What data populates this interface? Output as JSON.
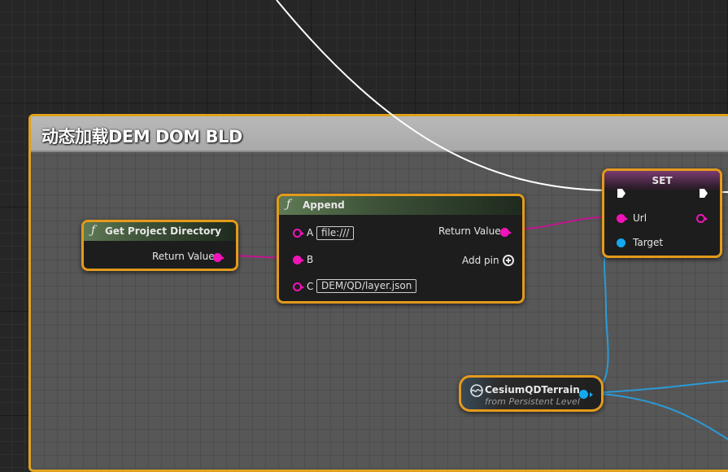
{
  "comment": {
    "title": "动态加载DEM DOM BLD"
  },
  "nodes": {
    "get_project_directory": {
      "fx": "ƒ",
      "title": "Get Project Directory",
      "return_label": "Return Value"
    },
    "append": {
      "fx": "ƒ",
      "title": "Append",
      "pin_a_label": "A",
      "pin_a_value": "file:///",
      "pin_b_label": "B",
      "pin_c_label": "C",
      "pin_c_value": "DEM/QD/layer.json",
      "return_label": "Return Value",
      "add_pin_label": "Add pin"
    },
    "set": {
      "title": "SET",
      "url_label": "Url",
      "target_label": "Target"
    },
    "cesium_var": {
      "title": "CesiumQDTerrain",
      "subtitle": "from Persistent Level"
    }
  },
  "colors": {
    "string_pin": "#f014b9",
    "object_pin": "#14a8f0",
    "selection_border": "#e39a1c",
    "exec_wire": "#ffffff"
  }
}
